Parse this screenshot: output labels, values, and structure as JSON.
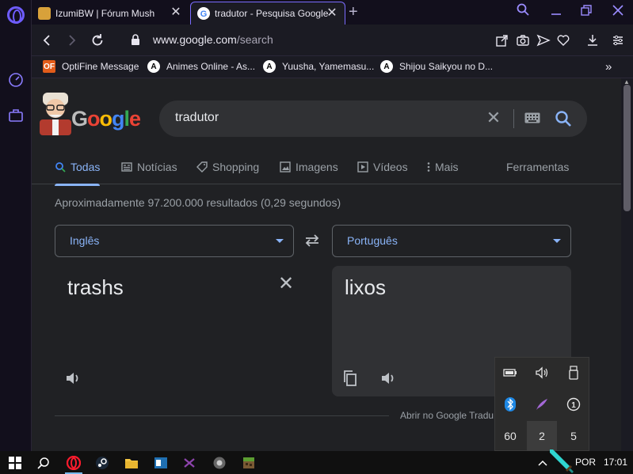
{
  "browser": {
    "tabs": [
      {
        "label": "IzumiBW | Fórum Mush",
        "favicon": "mush-favicon",
        "active": false
      },
      {
        "label": "tradutor - Pesquisa Google",
        "favicon": "google-favicon",
        "active": true
      }
    ],
    "new_tab": "+",
    "url_host": "www.google.com",
    "url_path": "/search",
    "bookmarks": [
      {
        "label": "OptiFine Message",
        "icon_text": "OF"
      },
      {
        "label": "Animes Online - As...",
        "icon_text": "A"
      },
      {
        "label": "Yuusha, Yamemasu...",
        "icon_text": "A"
      },
      {
        "label": "Shijou Saikyou no D...",
        "icon_text": "A"
      }
    ],
    "more": "»"
  },
  "google": {
    "logo_text": "Google",
    "query": "tradutor",
    "tabs": [
      {
        "label": "Todas",
        "icon": "search-icon",
        "active": true
      },
      {
        "label": "Notícias",
        "icon": "news-icon",
        "active": false
      },
      {
        "label": "Shopping",
        "icon": "tag-icon",
        "active": false
      },
      {
        "label": "Imagens",
        "icon": "image-icon",
        "active": false
      },
      {
        "label": "Vídeos",
        "icon": "play-icon",
        "active": false
      },
      {
        "label": "Mais",
        "icon": "more-vert-icon",
        "active": false
      }
    ],
    "tools": "Ferramentas",
    "results_stats": "Aproximadamente 97.200.000 resultados (0,29 segundos)",
    "translator": {
      "source_lang": "Inglês",
      "target_lang": "Português",
      "source_text": "trashs",
      "target_text": "lixos",
      "open_link": "Abrir no Google Tradu"
    }
  },
  "tray_popup": {
    "row3": [
      "60",
      "2",
      "5"
    ]
  },
  "taskbar": {
    "language": "POR",
    "time": "17:01"
  },
  "colors": {
    "accent_opera": "#7a6cff",
    "google_blue": "#8ab4f8",
    "page_bg": "#202124"
  }
}
